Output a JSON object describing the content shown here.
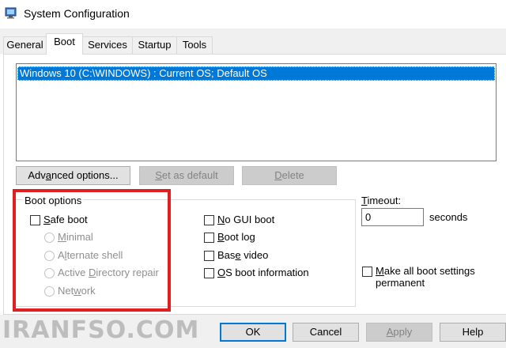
{
  "window": {
    "title": "System Configuration",
    "icon": "msconfig-icon"
  },
  "tabs": [
    {
      "label": "General",
      "active": false
    },
    {
      "label": "Boot",
      "active": true
    },
    {
      "label": "Services",
      "active": false
    },
    {
      "label": "Startup",
      "active": false
    },
    {
      "label": "Tools",
      "active": false
    }
  ],
  "os_list": {
    "items": [
      "Windows 10 (C:\\WINDOWS) : Current OS; Default OS"
    ],
    "selected_index": 0
  },
  "list_buttons": {
    "advanced_pre": "Adv",
    "advanced_key": "a",
    "advanced_post": "nced options...",
    "set_default_key": "S",
    "set_default_post": "et as default",
    "delete_key": "D",
    "delete_post": "elete"
  },
  "boot_options": {
    "title": "Boot options",
    "safe_boot_key": "S",
    "safe_boot_post": "afe boot",
    "minimal_key": "M",
    "minimal_post": "inimal",
    "alternate_shell_pre": "A",
    "alternate_shell_key": "l",
    "alternate_shell_post": "ternate shell",
    "ad_repair_pre": "Active ",
    "ad_repair_key": "D",
    "ad_repair_post": "irectory repair",
    "network_pre": "Net",
    "network_key": "w",
    "network_post": "ork",
    "no_gui_key": "N",
    "no_gui_post": "o GUI boot",
    "boot_log_pre": "",
    "boot_log_key": "B",
    "boot_log_post": "oot log",
    "base_video_pre": "Bas",
    "base_video_key": "e",
    "base_video_post": " video",
    "os_info_key": "O",
    "os_info_post": "S boot information"
  },
  "timeout": {
    "label_key": "T",
    "label_post": "imeout:",
    "value": "0",
    "units": "seconds"
  },
  "permanent": {
    "line1_key": "M",
    "line1_post": "ake all boot settings",
    "line2": "permanent"
  },
  "dialog_buttons": {
    "ok": "OK",
    "cancel": "Cancel",
    "apply_key": "A",
    "apply_post": "pply",
    "help": "Help"
  },
  "watermark": "IRANFSO.COM",
  "colors": {
    "selection": "#0078d7",
    "highlight_box": "#e02020"
  }
}
